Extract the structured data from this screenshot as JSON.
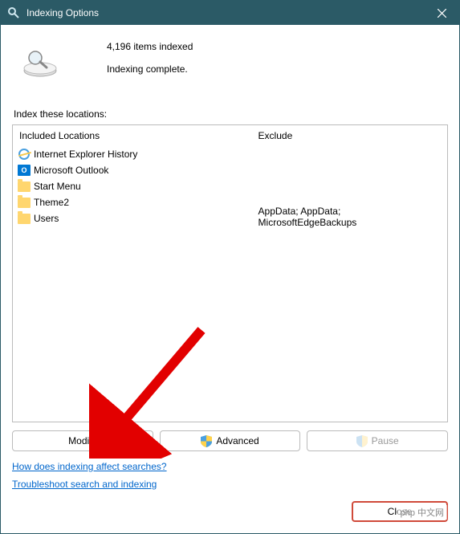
{
  "window": {
    "title": "Indexing Options"
  },
  "status": {
    "count_line": "4,196 items indexed",
    "state_line": "Indexing complete."
  },
  "locations": {
    "section_label": "Index these locations:",
    "included_header": "Included Locations",
    "exclude_header": "Exclude",
    "items": [
      {
        "label": "Internet Explorer History",
        "icon": "ie",
        "exclude": ""
      },
      {
        "label": "Microsoft Outlook",
        "icon": "outlook",
        "exclude": ""
      },
      {
        "label": "Start Menu",
        "icon": "folder",
        "exclude": ""
      },
      {
        "label": "Theme2",
        "icon": "folder",
        "exclude": ""
      },
      {
        "label": "Users",
        "icon": "folder",
        "exclude": "AppData; AppData; MicrosoftEdgeBackups"
      }
    ]
  },
  "buttons": {
    "modify": "Modify",
    "advanced": "Advanced",
    "pause": "Pause",
    "close": "Close"
  },
  "links": {
    "how": "How does indexing affect searches?",
    "troubleshoot": "Troubleshoot search and indexing"
  },
  "watermark": "php 中文网"
}
